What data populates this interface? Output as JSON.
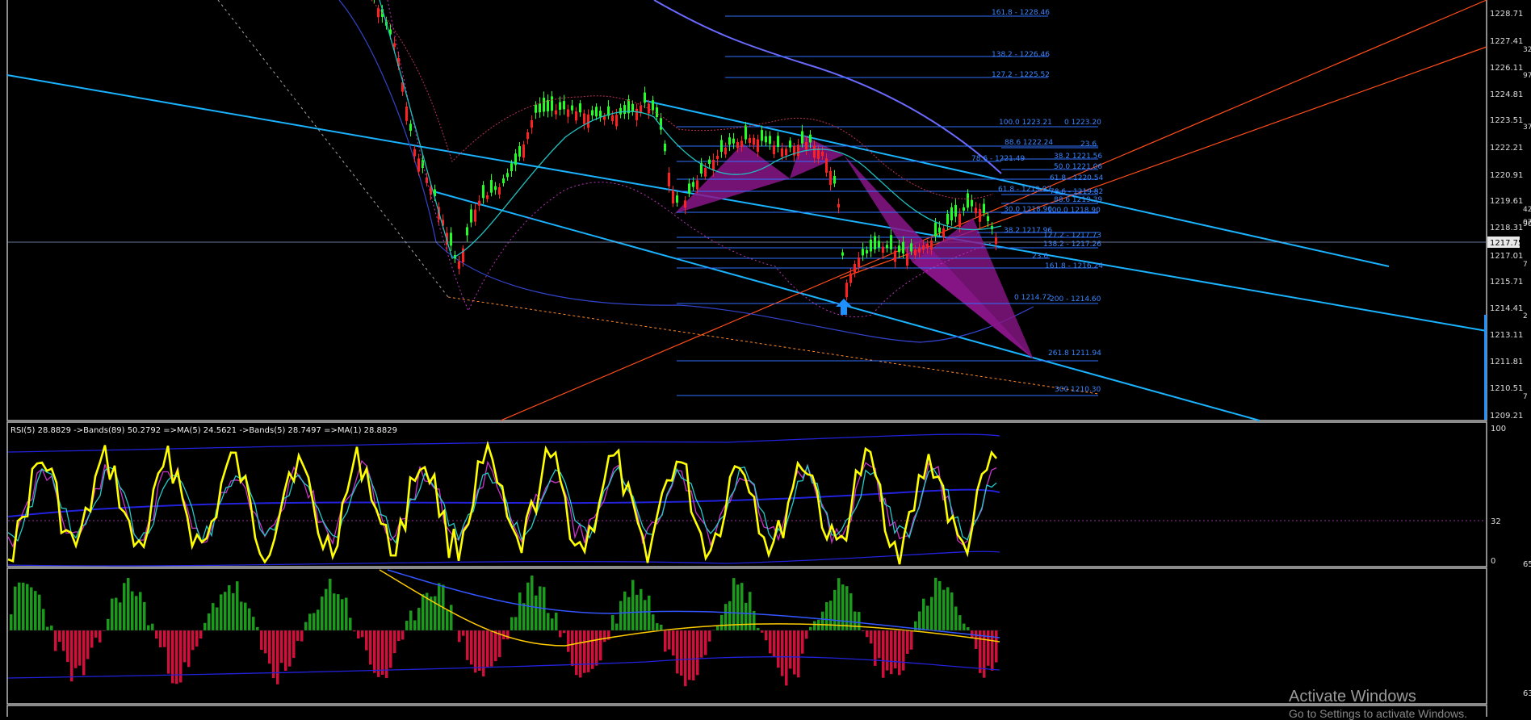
{
  "colors": {
    "background": "#000000",
    "border": "#b9b9b9",
    "trend_cyan": "#1ab3ff",
    "fib": "#2f70ff",
    "fib_text": "#3a86ff",
    "channel": "#ff4d1a",
    "pattern": "#8a168a",
    "rsi": "#ffff00",
    "hist_up": "#1b9b1b",
    "hist_down": "#d0103a",
    "bands": "#2222dd",
    "candle_up": "#22ff22",
    "candle_down": "#ff2020"
  },
  "price_axis": {
    "labels": [
      "1228.71",
      "1227.41",
      "1226.11",
      "1224.81",
      "1223.51",
      "1222.21",
      "1220.91",
      "1219.61",
      "1218.31",
      "1217.75",
      "1217.01",
      "1215.71",
      "1214.41",
      "1213.11",
      "1211.81",
      "1210.51",
      "1209.21"
    ],
    "current": "1217.75",
    "partial": [
      "32",
      "97",
      "37",
      "42",
      "07",
      "90",
      "7",
      "2",
      "7"
    ]
  },
  "fib_levels": [
    "161.8 - 1228.46",
    "138.2 - 1226.46",
    "127.2 - 1225.52",
    "100.0 1223.21",
    "0 1223.20",
    "88.6 1222.24",
    "23.6",
    "38.2 1221.56",
    "78.6 - 1221.49",
    "50.0 1221.06",
    "61.8 - 1220.54",
    "61.8 - 1219.97",
    "78.6 - 1219.82",
    "88.6 1219.39",
    "30.0 1218.90",
    "100.0 1218.90",
    "38.2 1217.96",
    "127.2 - 1217.73",
    "138.2 - 1217.26",
    "23.6",
    "161.8 - 1216.24",
    "0 1214.72",
    "200 - 1214.60",
    "261.8 1211.94",
    "300 1210.30"
  ],
  "rsi_panel": {
    "header": "RSI(5) 28.8829  ->Bands(89) 50.2792  =>MA(5) 24.5621  ->Bands(5) 28.7497  =>MA(1) 28.8829",
    "scale": [
      "100",
      "32",
      "0"
    ]
  },
  "macd_panel": {
    "scale": [
      "65",
      "63"
    ]
  },
  "watermark": {
    "title": "Activate Windows",
    "subtitle": "Go to Settings to activate Windows."
  }
}
